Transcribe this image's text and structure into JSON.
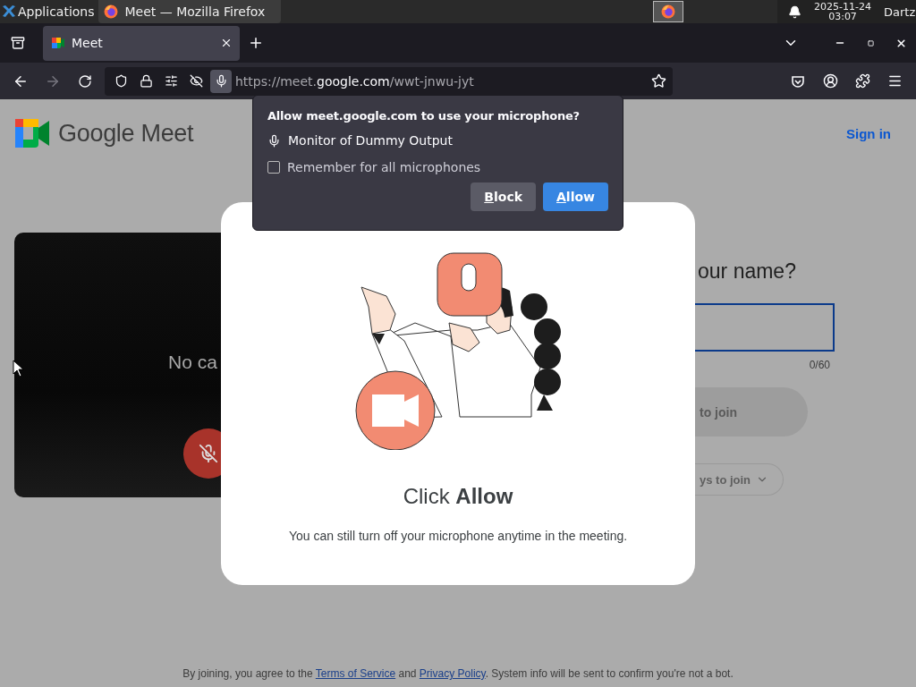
{
  "taskbar": {
    "apps_menu": "Applications",
    "window_button": "Meet — Mozilla Firefox",
    "date": "2025-11-24",
    "time": "03:07",
    "user": "Dartz"
  },
  "browser": {
    "tabs": [
      {
        "label": "Meet",
        "selected": true
      }
    ],
    "forward_disabled": true,
    "url": {
      "prefix": "https://meet.",
      "domain": "google.com",
      "path": "/wwt-jnwu-jyt"
    }
  },
  "permission_popup": {
    "title": "Allow meet.google.com to use your microphone?",
    "device": "Monitor of Dummy Output",
    "remember": {
      "label": "Remember for all microphones",
      "checked": false
    },
    "buttons": [
      {
        "label": "Block",
        "kind": "secondary"
      },
      {
        "label": "Allow",
        "kind": "primary"
      }
    ]
  },
  "page": {
    "logo": "Google Meet",
    "sign_in": "Sign in",
    "preview_text": "No ca",
    "name_prompt": "our name?",
    "name_counter": "0/60",
    "join_button": "to join",
    "other_ways_button": "ys to join",
    "footer": {
      "before": "By joining, you agree to the ",
      "terms": "Terms of Service",
      "middle": " and ",
      "privacy": "Privacy Policy",
      "after": ". System info will be sent to confirm you're not a bot."
    }
  },
  "modal": {
    "title": "Click **Allow**",
    "text": "You can still turn off your microphone anytime in the meeting."
  }
}
